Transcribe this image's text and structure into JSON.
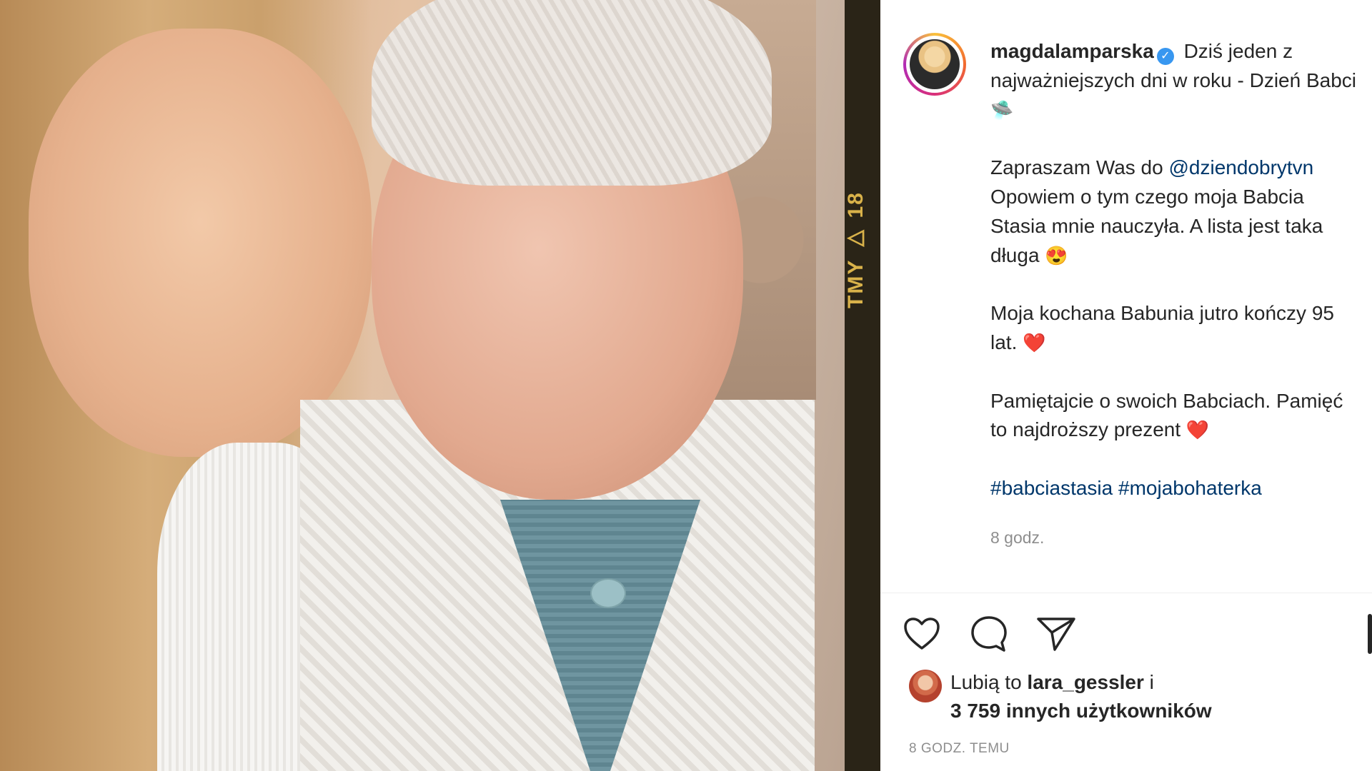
{
  "photo": {
    "film_label": "TMY ▷ 18"
  },
  "post": {
    "username": "magdalamparska",
    "verified": true,
    "caption_lines": {
      "p1_text": "Dziś jeden z najważniejszych dni w roku - Dzień Babci",
      "p2_prefix": "Zapraszam Was do ",
      "p2_mention": "@dziendobrytvn",
      "p2_text": " Opowiem o tym czego moja Babcia Stasia mnie nauczyła. A lista jest taka długa",
      "p3_text": "Moja kochana Babunia jutro kończy 95 lat.",
      "p4_text": "Pamiętajcie o swoich Babciach. Pamięć to najdroższy prezent",
      "hashtag1": "#babciastasia",
      "hashtag2": "#mojabohaterka"
    },
    "emojis": {
      "p1": "🛸",
      "p2": "😍",
      "p3": "❤️",
      "p4": "❤️"
    },
    "relative_time": "8 godz."
  },
  "actions": {
    "like_icon": "heart-icon",
    "comment_icon": "comment-icon",
    "share_icon": "paper-plane-icon"
  },
  "likes": {
    "prefix": "Lubią to ",
    "user": "lara_gessler",
    "suffix": " i",
    "count_text": "3 759 innych użytkowników"
  },
  "date_label": "8 GODZ. TEMU"
}
